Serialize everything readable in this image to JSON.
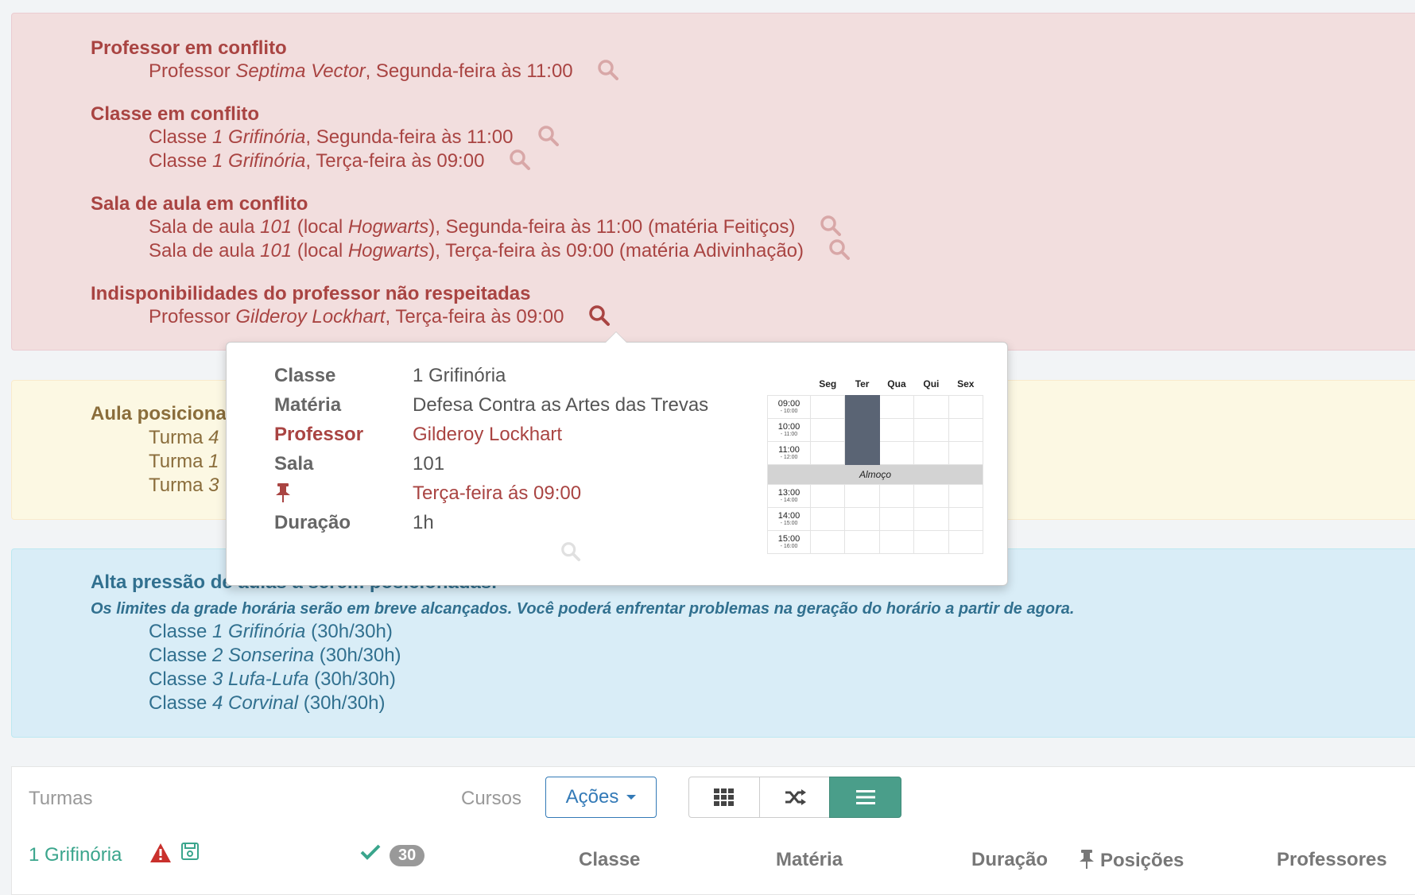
{
  "danger": {
    "sections": [
      {
        "title": "Professor em conflito",
        "items": [
          {
            "pre": "Professor ",
            "em": "Septima Vector",
            "post": ", Segunda-feira às 11:00"
          }
        ]
      },
      {
        "title": "Classe em conflito",
        "items": [
          {
            "pre": "Classe ",
            "em": "1 Grifinória",
            "post": ", Segunda-feira às 11:00"
          },
          {
            "pre": "Classe ",
            "em": "1 Grifinória",
            "post": ", Terça-feira às 09:00"
          }
        ]
      },
      {
        "title": "Sala de aula em conflito",
        "items": [
          {
            "pre": "Sala de aula ",
            "em": "101",
            "mid": " (local ",
            "em2": "Hogwarts",
            "post": "), Segunda-feira às 11:00 (matéria Feitiços)"
          },
          {
            "pre": "Sala de aula ",
            "em": "101",
            "mid": " (local ",
            "em2": "Hogwarts",
            "post": "), Terça-feira às 09:00 (matéria Adivinhação)"
          }
        ]
      },
      {
        "title": "Indisponibilidades do professor não respeitadas",
        "items": [
          {
            "pre": "Professor ",
            "em": "Gilderoy Lockhart",
            "post": ", Terça-feira às 09:00"
          }
        ]
      }
    ]
  },
  "warning": {
    "title": "Aula posiciona",
    "items": [
      {
        "pre": "Turma ",
        "em": "4"
      },
      {
        "pre": "Turma ",
        "em": "1"
      },
      {
        "pre": "Turma ",
        "em": "3"
      }
    ]
  },
  "info": {
    "title": "Alta pressão de aulas a serem posicionadas.",
    "subtitle": "Os limites da grade horária serão em breve alcançados. Você poderá enfrentar problemas na geração do horário a partir de agora.",
    "items": [
      {
        "pre": "Classe ",
        "em": "1 Grifinória",
        "post": " (30h/30h)"
      },
      {
        "pre": "Classe ",
        "em": "2 Sonserina",
        "post": " (30h/30h)"
      },
      {
        "pre": "Classe ",
        "em": "3 Lufa-Lufa",
        "post": " (30h/30h)"
      },
      {
        "pre": "Classe ",
        "em": "4 Corvinal",
        "post": " (30h/30h)"
      }
    ]
  },
  "popover": {
    "classe_label": "Classe",
    "classe_value": "1 Grifinória",
    "materia_label": "Matéria",
    "materia_value": "Defesa Contra as Artes das Trevas",
    "professor_label": "Professor",
    "professor_value": "Gilderoy Lockhart",
    "sala_label": "Sala",
    "sala_value": "101",
    "posicao_value": "Terça-feira ás 09:00",
    "duracao_label": "Duração",
    "duracao_value": "1h",
    "grid": {
      "days": [
        "Seg",
        "Ter",
        "Qua",
        "Qui",
        "Sex"
      ],
      "morning": [
        {
          "start": "09:00",
          "end": "- 10:00"
        },
        {
          "start": "10:00",
          "end": "- 11:00"
        },
        {
          "start": "11:00",
          "end": "- 12:00"
        }
      ],
      "lunch": "Almoço",
      "afternoon": [
        {
          "start": "13:00",
          "end": "- 14:00"
        },
        {
          "start": "14:00",
          "end": "- 15:00"
        },
        {
          "start": "15:00",
          "end": "- 16:00"
        }
      ]
    }
  },
  "bottom": {
    "turmas": "Turmas",
    "cursos": "Cursos",
    "acoes": "Ações",
    "row1_name": "1 Grifinória",
    "row1_count": "30",
    "col_classe": "Classe",
    "col_materia": "Matéria",
    "col_duracao": "Duração",
    "col_posicoes": "Posições",
    "col_professores": "Professores"
  },
  "colors": {
    "danger": "#a94442",
    "warning": "#8a6d3b",
    "info": "#31708f",
    "teal": "#4a9e8a",
    "success": "#3aa58c"
  }
}
